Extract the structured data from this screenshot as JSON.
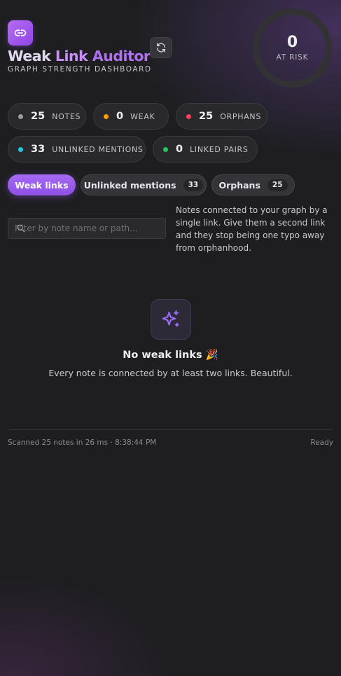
{
  "header": {
    "title_part1": "Weak ",
    "title_part2": "Link ",
    "title_part3": "Auditor",
    "subtitle": "GRAPH STRENGTH DASHBOARD",
    "logo_icon": "link-icon",
    "refresh_icon": "refresh-icon"
  },
  "risk": {
    "value": "0",
    "label": "AT RISK"
  },
  "stats": [
    {
      "value": "25",
      "label": "NOTES",
      "color": "#9a9aa2"
    },
    {
      "value": "0",
      "label": "WEAK",
      "color": "#f59e0b"
    },
    {
      "value": "25",
      "label": "ORPHANS",
      "color": "#f43f5e"
    },
    {
      "value": "33",
      "label": "UNLINKED MENTIONS",
      "color": "#22c5e6"
    },
    {
      "value": "0",
      "label": "LINKED PAIRS",
      "color": "#22c55e"
    }
  ],
  "tabs": [
    {
      "label": "Weak links",
      "badge": "",
      "active": true
    },
    {
      "label": "Unlinked mentions",
      "badge": "33",
      "active": false
    },
    {
      "label": "Orphans",
      "badge": "25",
      "active": false
    }
  ],
  "filter": {
    "placeholder": "Filter by note name or path...",
    "value": ""
  },
  "tab_description": "Notes connected to your graph by a single link. Give them a second link and they stop being one typo away from orphanhood.",
  "empty_state": {
    "icon": "sparkles-icon",
    "title": "No weak links 🎉",
    "text": "Every note is connected by at least two links. Beautiful."
  },
  "footer": {
    "scan_info": "Scanned 25 notes in 26 ms · 8:38:44 PM",
    "status": "Ready"
  }
}
